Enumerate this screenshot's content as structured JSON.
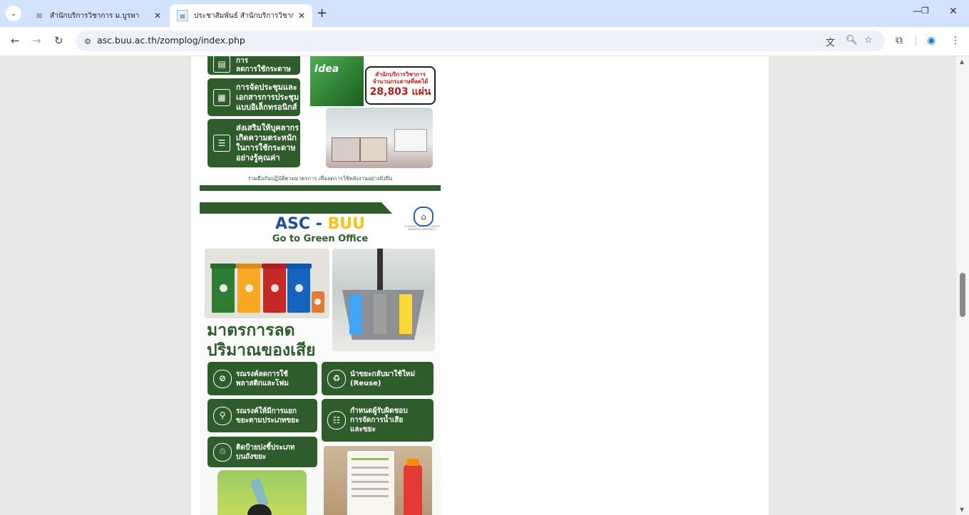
{
  "browser": {
    "tabs": [
      {
        "title": "สำนักบริการวิชาการ ม.บูรพา",
        "active": false
      },
      {
        "title": "ประชาสัมพันธ์ สำนักบริการวิชาการ",
        "active": true
      }
    ],
    "url": "asc.buu.ac.th/zomplog/index.php"
  },
  "poster1": {
    "card_partial": "ลดการใช้กระดาษ",
    "card_partial_top": "นำเทคโนโลยีเพื่อการ",
    "card2": "การจัดประชุมและ\nเอกสารการประชุม\nแบบอิเล็กทรอนิกส์",
    "card3": "ส่งเสริมให้บุคลากร\nเกิดความตระหนัก\nในการใช้กระดาษ\nอย่างรู้คุณค่า",
    "bubble_line1": "สำนักบริการวิชาการ",
    "bubble_line2": "จำนวนกระดาษที่ลดได้",
    "bubble_value": "28,803 แผ่น",
    "paper_brand": "Idea",
    "caption": "ร่วมมือกันปฏิบัติตามมาตรการ เพื่อลดการใช้พลังงานอย่างยั่งยืน"
  },
  "poster2": {
    "title_a": "ASC - ",
    "title_b": "BUU",
    "subtitle": "Go to Green Office",
    "logo_text": "ACADEMIC SERVICE CENTER BURAPHA UNIVERSITY",
    "heading_line1": "มาตรการลด",
    "heading_line2": "ปริมาณของเสีย",
    "cards": [
      "รณรงค์ลดการใช้\nพลาสติกและโฟม",
      "นำขยะกลับมาใช้ใหม่\n(Reuse)",
      "รณรงค์ให้มีการแยก\nขยะตามประเภทขยะ",
      "กำหนดผู้รับผิดชอบ\nการจัดการน้ำเสีย\nและขยะ",
      "ติดป้ายบ่งชี้ประเภท\nบนถังขยะ"
    ],
    "bin_colors": [
      "#2e7d32",
      "#f9a825",
      "#c62828",
      "#1565c0"
    ]
  },
  "colors": {
    "poster_green": "#2f5c2b",
    "title_blue": "#1e4f9a",
    "title_yellow": "#f4c21a",
    "value_red": "#b71c1c"
  }
}
